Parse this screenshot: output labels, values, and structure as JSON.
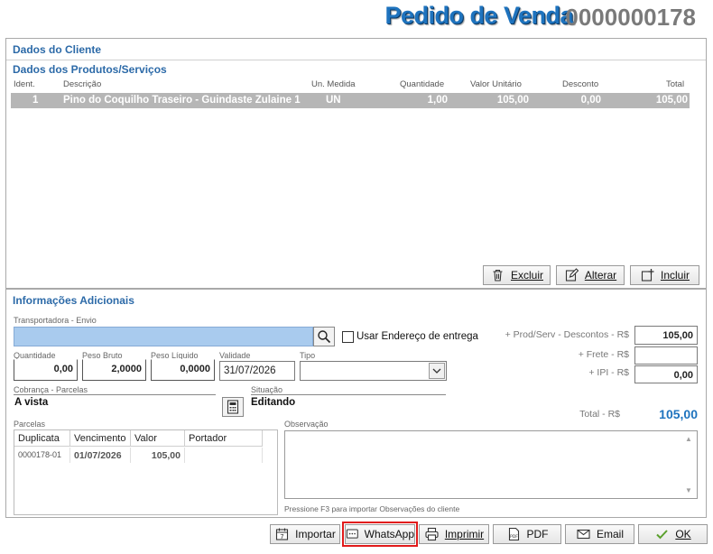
{
  "header": {
    "title": "Pedido de Venda",
    "order_number": "0000000178"
  },
  "client_section": {
    "title": "Dados do Cliente"
  },
  "products": {
    "title": "Dados dos Produtos/Serviços",
    "columns": [
      "Ident.",
      "Descrição",
      "Un. Medida",
      "Quantidade",
      "Valor Unitário",
      "Desconto",
      "Total"
    ],
    "rows": [
      {
        "ident": "1",
        "descricao": "Pino do Coquilho Traseiro - Guindaste Zulaine 1",
        "un": "UN",
        "quantidade": "1,00",
        "valor_unitario": "105,00",
        "desconto": "0,00",
        "total": "105,00"
      }
    ],
    "buttons": {
      "excluir": "Excluir",
      "alterar": "Alterar",
      "incluir": "Incluir"
    }
  },
  "info": {
    "title": "Informações Adicionais",
    "transportadora_label": "Transportadora - Envio",
    "transportadora_value": "",
    "usar_endereco_label": "Usar Endereço de entrega",
    "quantidade_label": "Quantidade",
    "quantidade_value": "0,00",
    "peso_bruto_label": "Peso Bruto",
    "peso_bruto_value": "2,0000",
    "peso_liquido_label": "Peso Líquido",
    "peso_liquido_value": "0,0000",
    "validade_label": "Validade",
    "validade_value": "31/07/2026",
    "tipo_label": "Tipo",
    "tipo_value": "",
    "cobranca_label": "Cobrança - Parcelas",
    "cobranca_value": "A vista",
    "situacao_label": "Situação",
    "situacao_value": "Editando",
    "parcelas_label": "Parcelas",
    "parcelas_columns": [
      "Duplicata",
      "Vencimento",
      "Valor",
      "Portador"
    ],
    "parcelas_rows": [
      {
        "duplicata": "0000178-01",
        "vencimento": "01/07/2026",
        "valor": "105,00",
        "portador": ""
      }
    ],
    "observacao_label": "Observação",
    "observacao_hint": "Pressione F3 para importar Observações do cliente"
  },
  "totals": {
    "prod_label": "+ Prod/Serv - Descontos - R$",
    "prod_value": "105,00",
    "frete_label": "+ Frete - R$",
    "frete_value": "",
    "ipi_label": "+ IPI - R$",
    "ipi_value": "0,00",
    "total_label": "Total - R$",
    "total_value": "105,00",
    "accent": "#1e73be"
  },
  "footer_buttons": {
    "importar": "Importar",
    "whatsapp": "WhatsApp",
    "imprimir": "Imprimir",
    "pdf": "PDF",
    "email": "Email",
    "ok": "OK"
  },
  "icons": [
    "trash-icon",
    "edit-icon",
    "add-icon",
    "search-icon",
    "calculator-icon",
    "calendar-icon",
    "chat-icon",
    "printer-icon",
    "pdf-icon",
    "email-icon",
    "check-icon",
    "chevron-down-icon"
  ]
}
